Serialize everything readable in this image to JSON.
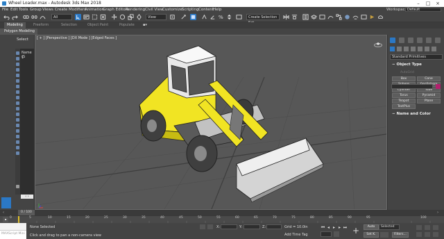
{
  "window": {
    "title": "Wheel Loader.max - Autodesk 3ds Max 2018"
  },
  "menu": {
    "items": [
      "File",
      "Edit",
      "Tools",
      "Group",
      "Views",
      "Create",
      "Modifiers",
      "Animation",
      "Graph Editors",
      "Rendering",
      "Civil View",
      "Customize",
      "Scripting",
      "Content",
      "Help"
    ],
    "workspaces_label": "Workspaces:",
    "workspaces_value": "Default"
  },
  "toolbar": {
    "filter_value": "All",
    "view_value": "View",
    "selection_set_value": "Create Selection Set"
  },
  "ribbon": {
    "tabs": [
      "Modeling",
      "Freeform",
      "Selection",
      "Object Paint",
      "Populate"
    ],
    "active_tab": "Modeling",
    "sub_label": "Polygon Modeling"
  },
  "scene_explorer": {
    "header": "Select",
    "rows": [
      "Name (S",
      "1"
    ]
  },
  "viewport": {
    "label": "[ + ] [Perspective ] [DX Mode ] [Edged Faces ]",
    "body_color": "#f1e423",
    "cab_color": "#e8e8e8",
    "tire_color": "#3f3f3f",
    "bucket_color": "#d4d4d4"
  },
  "command_panel": {
    "dropdown": "Standard Primitives",
    "object_type_header": "Object Type",
    "autogrid": "AutoGrid",
    "buttons": [
      "Box",
      "Cone",
      "Sphere",
      "GeoSphere",
      "Cylinder",
      "Tube",
      "Torus",
      "Pyramid",
      "Teapot",
      "Plane",
      "TextPlus"
    ],
    "name_color_header": "Name and Color",
    "swatch_color": "#b4206e"
  },
  "timeline": {
    "slider_label": "0 / 100",
    "ticks": [
      "0",
      "5",
      "10",
      "15",
      "20",
      "25",
      "30",
      "35",
      "40",
      "45",
      "50",
      "55",
      "60",
      "65",
      "70",
      "75",
      "80",
      "85",
      "90",
      "95",
      "100"
    ]
  },
  "status": {
    "maxscript": "MAXScript Mini",
    "selected": "None Selected",
    "prompt": "Click and drag to pan a non-camera view",
    "x_label": "X:",
    "y_label": "Y:",
    "z_label": "Z:",
    "grid": "Grid = 10.0in",
    "add_time_tag": "Add Time Tag",
    "auto_label": "Auto",
    "set_key_label": "Set K.",
    "selected_dd": "Selected",
    "filters_label": "Filters..."
  }
}
